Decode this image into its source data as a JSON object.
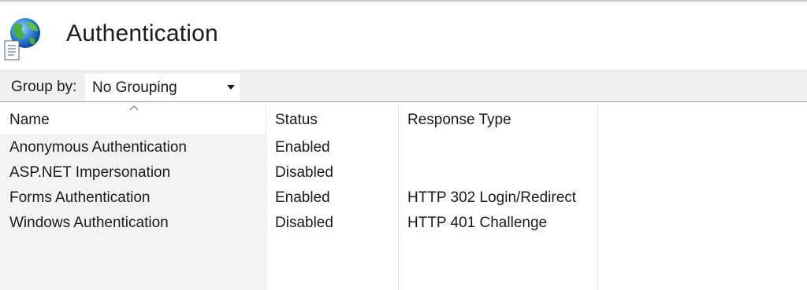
{
  "header": {
    "title": "Authentication",
    "icon": "globe-document-icon"
  },
  "toolbar": {
    "group_by_label": "Group by:",
    "group_by_value": "No Grouping"
  },
  "table": {
    "columns": [
      {
        "key": "name",
        "label": "Name",
        "sorted": "ascending"
      },
      {
        "key": "status",
        "label": "Status"
      },
      {
        "key": "response_type",
        "label": "Response Type"
      }
    ],
    "rows": [
      {
        "name": "Anonymous Authentication",
        "status": "Enabled",
        "response_type": ""
      },
      {
        "name": "ASP.NET Impersonation",
        "status": "Disabled",
        "response_type": ""
      },
      {
        "name": "Forms Authentication",
        "status": "Enabled",
        "response_type": "HTTP 302 Login/Redirect"
      },
      {
        "name": "Windows Authentication",
        "status": "Disabled",
        "response_type": "HTTP 401 Challenge"
      }
    ]
  }
}
